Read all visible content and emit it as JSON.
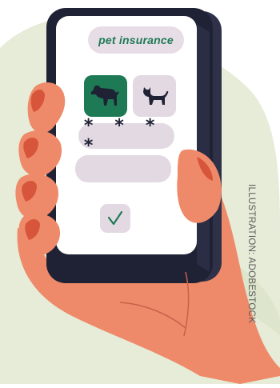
{
  "app": {
    "title": "pet insurance",
    "pin_mask": "* * * *",
    "pet_options": [
      "dog",
      "cat"
    ],
    "selected_pet": "dog",
    "confirm_icon": "checkmark-icon"
  },
  "credit": "ILLUSTRATION: ADOBESTOCK",
  "colors": {
    "accent": "#1e7a55",
    "phone_frame": "#1f2235",
    "screen": "#ffffff",
    "pill": "#e2d9e2",
    "skin": "#ee8a6a",
    "nails": "#d7553a",
    "backdrop": "#e6ecd8"
  }
}
